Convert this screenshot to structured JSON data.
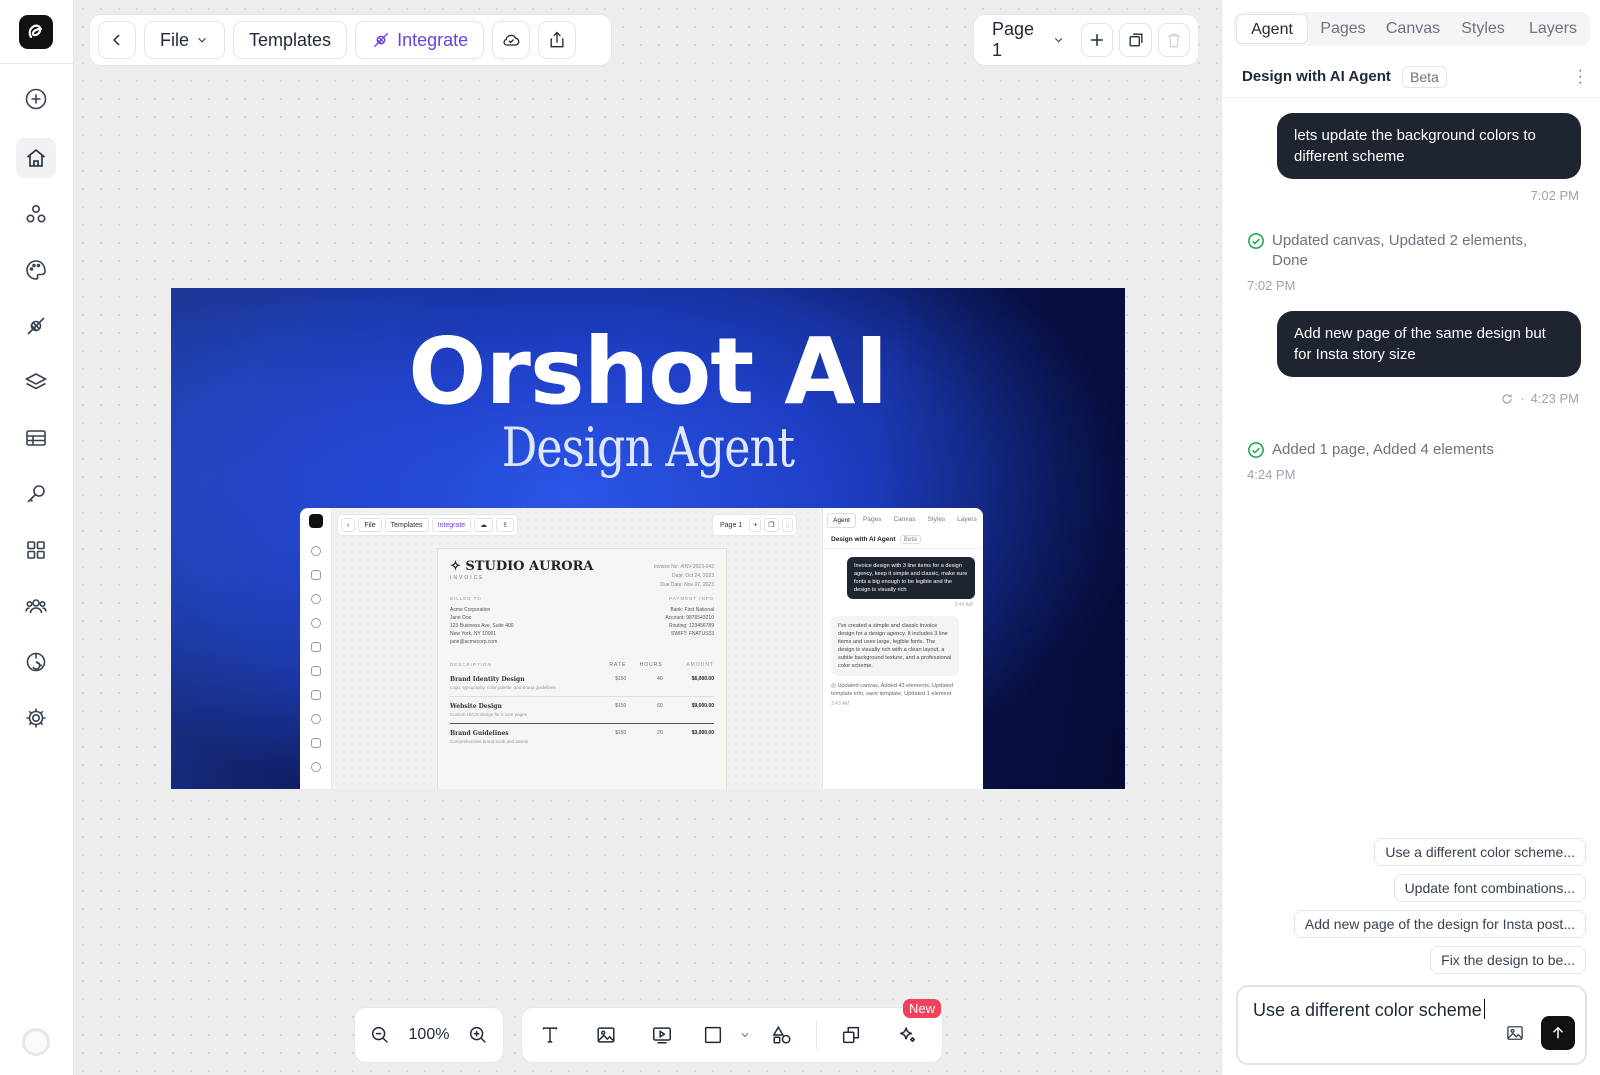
{
  "toolbar": {
    "file_label": "File",
    "templates_label": "Templates",
    "integrate_label": "Integrate",
    "page_label": "Page 1"
  },
  "artboard": {
    "title": "Orshot AI",
    "subtitle": "Design Agent"
  },
  "mini_app": {
    "file": "File",
    "templates": "Templates",
    "integrate": "Integrate",
    "page": "Page 1",
    "tabs": [
      "Agent",
      "Pages",
      "Canvas",
      "Styles",
      "Layers"
    ],
    "panel_title": "Design with AI Agent",
    "beta": "Beta",
    "user_message": "Invoice design with 3 line items for a design agency, keep it simple and classic, make sure fonts a big enough to be legible and the design is visually rich",
    "user_time": "3:49 AM",
    "agent_reply": "I've created a simple and classic invoice design for a design agency. It includes 3 line items and uses large, legible fonts. The design is visually rich with a clean layout, a subtle background texture, and a professional color scheme.",
    "agent_status": "Updated canvas, Added 43 elements, Updated template info, save template, Updated 1 element",
    "agent_time": "3:43 AM",
    "invoice": {
      "company": "STUDIO AURORA",
      "doc": "INVOICE",
      "meta": [
        "Invoice No: #INV-2023-042",
        "Date: Oct 24, 2023",
        "Due Date: Nov 07, 2023"
      ],
      "billed_to_label": "BILLED TO",
      "billed_to": [
        "Acme Corporation",
        "Jane Doe",
        "123 Business Ave, Suite 400",
        "New York, NY 10001",
        "jane@acmecorp.com"
      ],
      "payment_label": "PAYMENT INFO",
      "payment": [
        "Bank: First National",
        "Account: 9876543210",
        "Routing: 123456789",
        "SWIFT: FNATUS33"
      ],
      "headers": [
        "DESCRIPTION",
        "RATE",
        "HOURS",
        "AMOUNT"
      ],
      "items": [
        {
          "name": "Brand Identity Design",
          "desc": "Logo, typography, color palette, and brand guidelines",
          "rate": "$150",
          "hours": "40",
          "amount": "$6,000.00"
        },
        {
          "name": "Website Design",
          "desc": "Custom UI/UX design for 5 core pages",
          "rate": "$150",
          "hours": "60",
          "amount": "$9,000.00"
        },
        {
          "name": "Brand Guidelines",
          "desc": "Comprehensive brand book and assets",
          "rate": "$150",
          "hours": "20",
          "amount": "$3,000.00"
        }
      ]
    }
  },
  "bottom_toolbar": {
    "zoom": "100%",
    "new_badge": "New"
  },
  "panel": {
    "tabs": [
      "Agent",
      "Pages",
      "Canvas",
      "Styles",
      "Layers"
    ],
    "title": "Design with AI Agent",
    "beta": "Beta",
    "messages": [
      {
        "text": "lets update the background colors to different scheme",
        "time": "7:02 PM"
      },
      {
        "text": "Add new page of the same design but for Insta story size",
        "time": "4:23 PM"
      }
    ],
    "statuses": [
      {
        "text": "Updated canvas, Updated 2 elements, Done",
        "time": "7:02 PM"
      },
      {
        "text": "Added 1 page, Added 4 elements",
        "time": "4:24 PM"
      }
    ],
    "time_sep": "·",
    "suggestions": [
      "Use a different color scheme...",
      "Update font combinations...",
      "Add new page of the design for Insta post...",
      "Fix the design to be..."
    ],
    "composer_text": "Use a different color scheme"
  },
  "colors": {
    "accent": "#6d3fe0",
    "dark_bubble": "#1e2430",
    "success": "#16a34a",
    "badge": "#f0425d",
    "artboard_blue": "#1e3fc6"
  },
  "icons": {
    "sidebar": [
      "plus-circle-icon",
      "home-icon",
      "elements-icon",
      "palette-icon",
      "integrate-icon",
      "layers-icon",
      "table-icon",
      "key-icon",
      "apps-icon",
      "team-icon",
      "brand-icon",
      "settings-icon"
    ]
  }
}
